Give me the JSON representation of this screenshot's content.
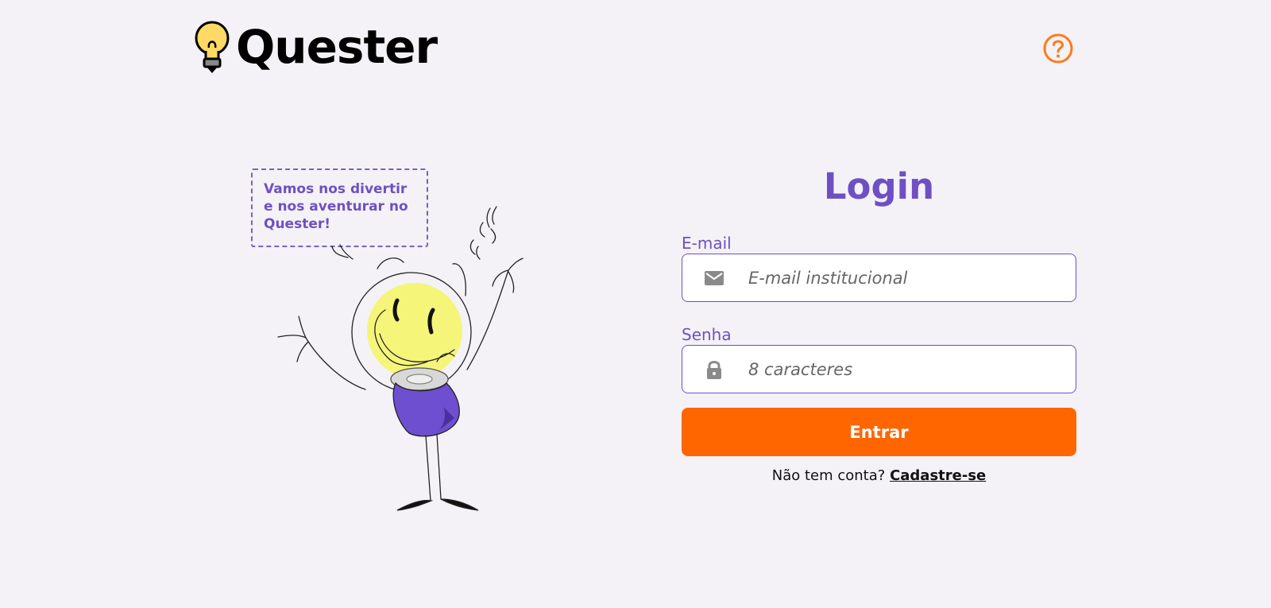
{
  "brand": {
    "name": "Quester",
    "accent_color": "#6e50c4",
    "primary_color": "#ff6600",
    "logo_bulb_color": "#ffd966"
  },
  "header": {
    "help_icon": "question-circle-icon"
  },
  "illustration": {
    "speech_lines": [
      "Vamos nos divertir",
      "e nos aventurar no",
      "Quester!"
    ]
  },
  "login": {
    "title": "Login",
    "email_label": "E-mail",
    "email_placeholder": "E-mail institucional",
    "email_icon": "envelope-icon",
    "password_label": "Senha",
    "password_placeholder": "8 caracteres",
    "password_icon": "lock-icon",
    "submit_label": "Entrar",
    "signup_prompt": "Não tem conta?",
    "signup_link": "Cadastre-se"
  }
}
